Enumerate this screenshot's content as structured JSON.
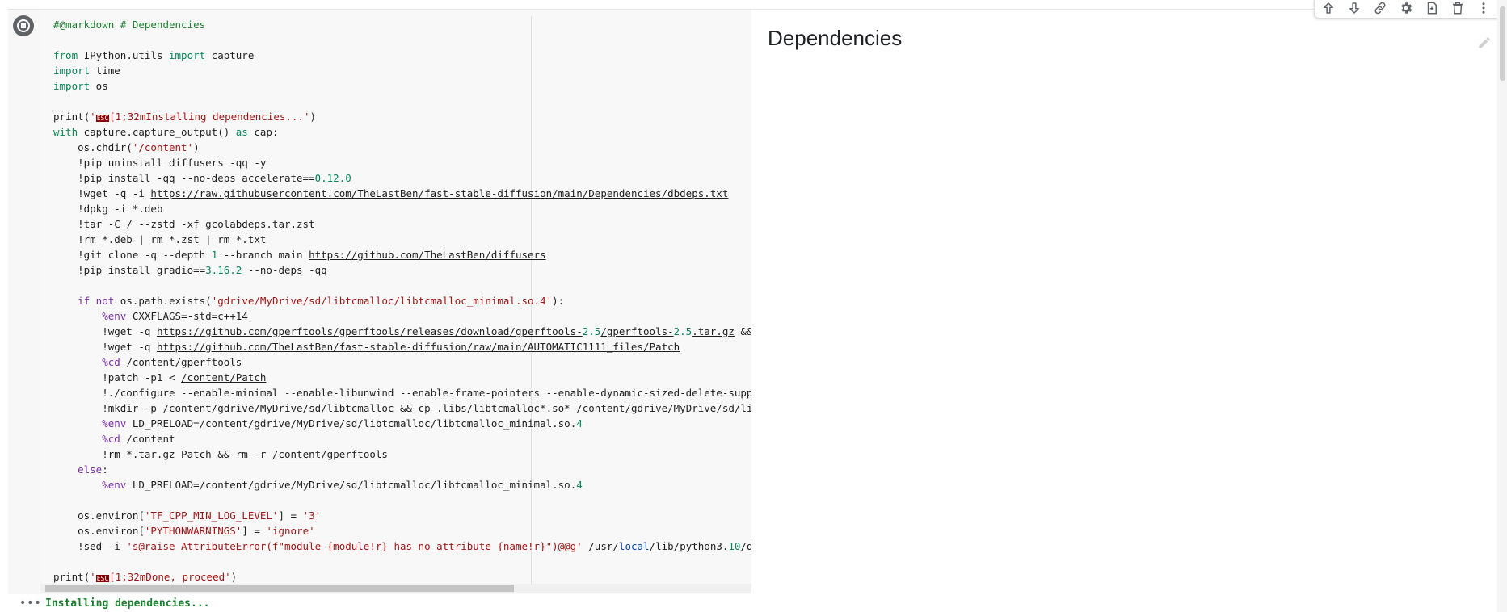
{
  "cell": {
    "code_lines": [
      [
        {
          "t": "#@markdown # Dependencies",
          "c": "cmt"
        }
      ],
      [],
      [
        {
          "t": "from",
          "c": "kwg"
        },
        {
          "t": " IPython.utils "
        },
        {
          "t": "import",
          "c": "kwg"
        },
        {
          "t": " capture"
        }
      ],
      [
        {
          "t": "import",
          "c": "kwg"
        },
        {
          "t": " time"
        }
      ],
      [
        {
          "t": "import",
          "c": "kwg"
        },
        {
          "t": " os"
        }
      ],
      [],
      [
        {
          "t": "print("
        },
        {
          "t": "'",
          "c": "str"
        },
        {
          "t": "ESC",
          "c": "esc"
        },
        {
          "t": "[1;32mInstalling dependencies...'",
          "c": "str"
        },
        {
          "t": ")"
        }
      ],
      [
        {
          "t": "with",
          "c": "kwg"
        },
        {
          "t": " capture.capture_output() "
        },
        {
          "t": "as",
          "c": "kwg"
        },
        {
          "t": " cap:"
        }
      ],
      [
        {
          "t": "    os.chdir("
        },
        {
          "t": "'/content'",
          "c": "str"
        },
        {
          "t": ")"
        }
      ],
      [
        {
          "t": "    !pip uninstall diffusers -qq -y"
        }
      ],
      [
        {
          "t": "    !pip install -qq --no-deps accelerate=="
        },
        {
          "t": "0.12.0",
          "c": "num"
        }
      ],
      [
        {
          "t": "    !wget -q -i "
        },
        {
          "t": "https://raw.githubusercontent.com/TheLastBen/fast-stable-diffusion/main/Dependencies/dbdeps.txt",
          "c": "link"
        }
      ],
      [
        {
          "t": "    !dpkg -i *.deb"
        }
      ],
      [
        {
          "t": "    !tar -C / --zstd -xf gcolabdeps.tar.zst"
        }
      ],
      [
        {
          "t": "    !rm *.deb | rm *.zst | rm *.txt"
        }
      ],
      [
        {
          "t": "    !git clone -q --depth "
        },
        {
          "t": "1",
          "c": "num"
        },
        {
          "t": " --branch main "
        },
        {
          "t": "https://github.com/TheLastBen/diffusers",
          "c": "link"
        }
      ],
      [
        {
          "t": "    !pip install gradio=="
        },
        {
          "t": "3.16.2",
          "c": "num"
        },
        {
          "t": " --no-deps -qq"
        }
      ],
      [],
      [
        {
          "t": "    "
        },
        {
          "t": "if not",
          "c": "kw"
        },
        {
          "t": " os.path.exists("
        },
        {
          "t": "'gdrive/MyDrive/sd/libtcmalloc/libtcmalloc_minimal.so.4'",
          "c": "str"
        },
        {
          "t": "):"
        }
      ],
      [
        {
          "t": "        "
        },
        {
          "t": "%env",
          "c": "mag"
        },
        {
          "t": " CXXFLAGS=-std=c++14"
        }
      ],
      [
        {
          "t": "        !wget -q "
        },
        {
          "t": "https://github.com/gperftools/gperftools/releases/download/gperftools-",
          "c": "link"
        },
        {
          "t": "2.5",
          "c": "num"
        },
        {
          "t": "/gperftools-",
          "c": "link"
        },
        {
          "t": "2.5",
          "c": "num"
        },
        {
          "t": ".tar.gz",
          "c": "link"
        },
        {
          "t": " && tar zxf"
        }
      ],
      [
        {
          "t": "        !wget -q "
        },
        {
          "t": "https://github.com/TheLastBen/fast-stable-diffusion/raw/main/AUTOMATIC1111_files/Patch",
          "c": "link"
        }
      ],
      [
        {
          "t": "        "
        },
        {
          "t": "%cd",
          "c": "mag"
        },
        {
          "t": " "
        },
        {
          "t": "/content/gperftools",
          "c": "link"
        }
      ],
      [
        {
          "t": "        !patch -p1 < "
        },
        {
          "t": "/content/Patch",
          "c": "link"
        }
      ],
      [
        {
          "t": "        !./configure --enable-minimal --enable-libunwind --enable-frame-pointers --enable-dynamic-sized-delete-support --ena"
        }
      ],
      [
        {
          "t": "        !mkdir -p "
        },
        {
          "t": "/content/gdrive/MyDrive/sd/libtcmalloc",
          "c": "link"
        },
        {
          "t": " && cp .libs/libtcmalloc*.so* "
        },
        {
          "t": "/content/gdrive/MyDrive/sd/libtcmalloc",
          "c": "link"
        }
      ],
      [
        {
          "t": "        "
        },
        {
          "t": "%env",
          "c": "mag"
        },
        {
          "t": " LD_PRELOAD=/content/gdrive/MyDrive/sd/libtcmalloc/libtcmalloc_minimal.so."
        },
        {
          "t": "4",
          "c": "num"
        }
      ],
      [
        {
          "t": "        "
        },
        {
          "t": "%cd",
          "c": "mag"
        },
        {
          "t": " /content"
        }
      ],
      [
        {
          "t": "        !rm *.tar.gz Patch && rm -r "
        },
        {
          "t": "/content/gperftools",
          "c": "link"
        }
      ],
      [
        {
          "t": "    "
        },
        {
          "t": "else",
          "c": "kw"
        },
        {
          "t": ":"
        }
      ],
      [
        {
          "t": "        "
        },
        {
          "t": "%env",
          "c": "mag"
        },
        {
          "t": " LD_PRELOAD=/content/gdrive/MyDrive/sd/libtcmalloc/libtcmalloc_minimal.so."
        },
        {
          "t": "4",
          "c": "num"
        }
      ],
      [],
      [
        {
          "t": "    os.environ["
        },
        {
          "t": "'TF_CPP_MIN_LOG_LEVEL'",
          "c": "str"
        },
        {
          "t": "] = "
        },
        {
          "t": "'3'",
          "c": "str"
        }
      ],
      [
        {
          "t": "    os.environ["
        },
        {
          "t": "'PYTHONWARNINGS'",
          "c": "str"
        },
        {
          "t": "] = "
        },
        {
          "t": "'ignore'",
          "c": "str"
        }
      ],
      [
        {
          "t": "    !sed -i "
        },
        {
          "t": "'s@raise AttributeError(f\"module {module!r} has no attribute {name!r}\")@@g'",
          "c": "str"
        },
        {
          "t": " "
        },
        {
          "t": "/usr/",
          "c": "link"
        },
        {
          "t": "local",
          "c": "localkw"
        },
        {
          "t": "/lib/python3.",
          "c": "link"
        },
        {
          "t": "10",
          "c": "num"
        },
        {
          "t": "/dist-packa",
          "c": "link"
        }
      ],
      [],
      [
        {
          "t": "print("
        },
        {
          "t": "'",
          "c": "str"
        },
        {
          "t": "ESC",
          "c": "esc"
        },
        {
          "t": "[1;32mDone, proceed'",
          "c": "str"
        },
        {
          "t": ")"
        }
      ]
    ]
  },
  "preview": {
    "title": "Dependencies"
  },
  "toolbar": {
    "buttons": [
      {
        "name": "move-cell-up-button",
        "icon": "arrow-up-icon"
      },
      {
        "name": "move-cell-down-button",
        "icon": "arrow-down-icon"
      },
      {
        "name": "copy-link-button",
        "icon": "link-icon"
      },
      {
        "name": "cell-settings-button",
        "icon": "gear-icon"
      },
      {
        "name": "mirror-cell-button",
        "icon": "mirror-icon"
      },
      {
        "name": "delete-cell-button",
        "icon": "trash-icon"
      },
      {
        "name": "more-options-button",
        "icon": "more-vert-icon"
      }
    ]
  },
  "output": {
    "menu_label": "•••",
    "text": "Installing dependencies..."
  }
}
